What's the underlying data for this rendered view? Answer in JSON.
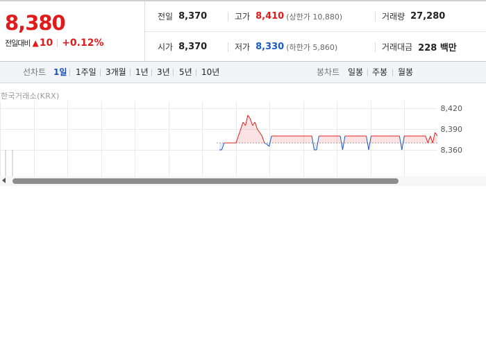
{
  "quote": {
    "price": "8,380",
    "change_label": "전일대비",
    "change_icon": "up-triangle-icon",
    "change_amount": "10",
    "change_rate": "+0.12%",
    "colors": {
      "up": "#e01b1b",
      "down": "#1a5cc4"
    }
  },
  "stats": {
    "prev_close": {
      "label": "전일",
      "value": "8,370"
    },
    "high": {
      "label": "고가",
      "value": "8,410",
      "sub": "(상한가 10,880)"
    },
    "volume": {
      "label": "거래량",
      "value": "27,280"
    },
    "open": {
      "label": "시가",
      "value": "8,370"
    },
    "low": {
      "label": "저가",
      "value": "8,330",
      "sub": "(하한가 5,860)"
    },
    "trade_value": {
      "label": "거래대금",
      "value": "228 백만"
    }
  },
  "periods": {
    "label": "선차트",
    "items": [
      "1일",
      "1주일",
      "3개월",
      "1년",
      "3년",
      "5년",
      "10년"
    ],
    "active": "1일"
  },
  "candles": {
    "label": "봉차트",
    "items": [
      "일봉",
      "주봉",
      "월봉"
    ]
  },
  "exchange": "한국거래소(KRX)",
  "chart_data": {
    "type": "line",
    "title": "",
    "reference": 8370,
    "y_ticks": [
      "8,420",
      "8,390",
      "8,360"
    ],
    "ylim": [
      8330,
      8430
    ],
    "grid": true,
    "series": [
      {
        "values": [
          8360,
          8360,
          8370,
          8370,
          8370,
          8370,
          8370,
          8370,
          8380,
          8390,
          8400,
          8395,
          8410,
          8405,
          8395,
          8400,
          8390,
          8385,
          8380,
          8370,
          8368,
          8365,
          8380,
          8380,
          8380,
          8380,
          8380,
          8380,
          8380,
          8380,
          8380,
          8380,
          8380,
          8380,
          8380,
          8380,
          8380,
          8380,
          8380,
          8380,
          8360,
          8360,
          8380,
          8380,
          8380,
          8380,
          8380,
          8380,
          8380,
          8380,
          8380,
          8380,
          8360,
          8380,
          8380,
          8380,
          8380,
          8380,
          8380,
          8380,
          8380,
          8380,
          8380,
          8360,
          8380,
          8380,
          8380,
          8380,
          8380,
          8380,
          8380,
          8380,
          8380,
          8380,
          8380,
          8380,
          8380,
          8360,
          8380,
          8380,
          8380,
          8380,
          8380,
          8380,
          8380,
          8380,
          8380,
          8380,
          8370,
          8380,
          8370,
          8385,
          8380
        ]
      }
    ]
  }
}
